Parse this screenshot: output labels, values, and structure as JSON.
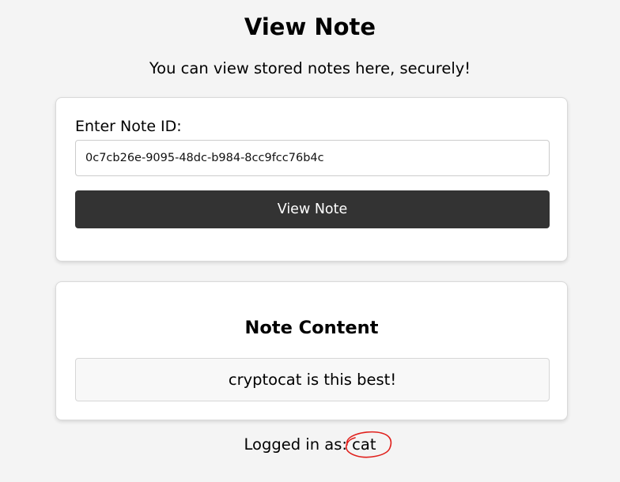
{
  "page": {
    "title": "View Note",
    "subtitle": "You can view stored notes here, securely!"
  },
  "form": {
    "label": "Enter Note ID:",
    "note_id_value": "0c7cb26e-9095-48dc-b984-8cc9fcc76b4c",
    "button_label": "View Note"
  },
  "content": {
    "heading": "Note Content",
    "text": "cryptocat is this best!"
  },
  "footer": {
    "logged_in_prefix": "Logged in as:",
    "username": "cat"
  },
  "colors": {
    "background": "#f4f4f4",
    "button": "#333333",
    "annotation": "#e0201c"
  }
}
